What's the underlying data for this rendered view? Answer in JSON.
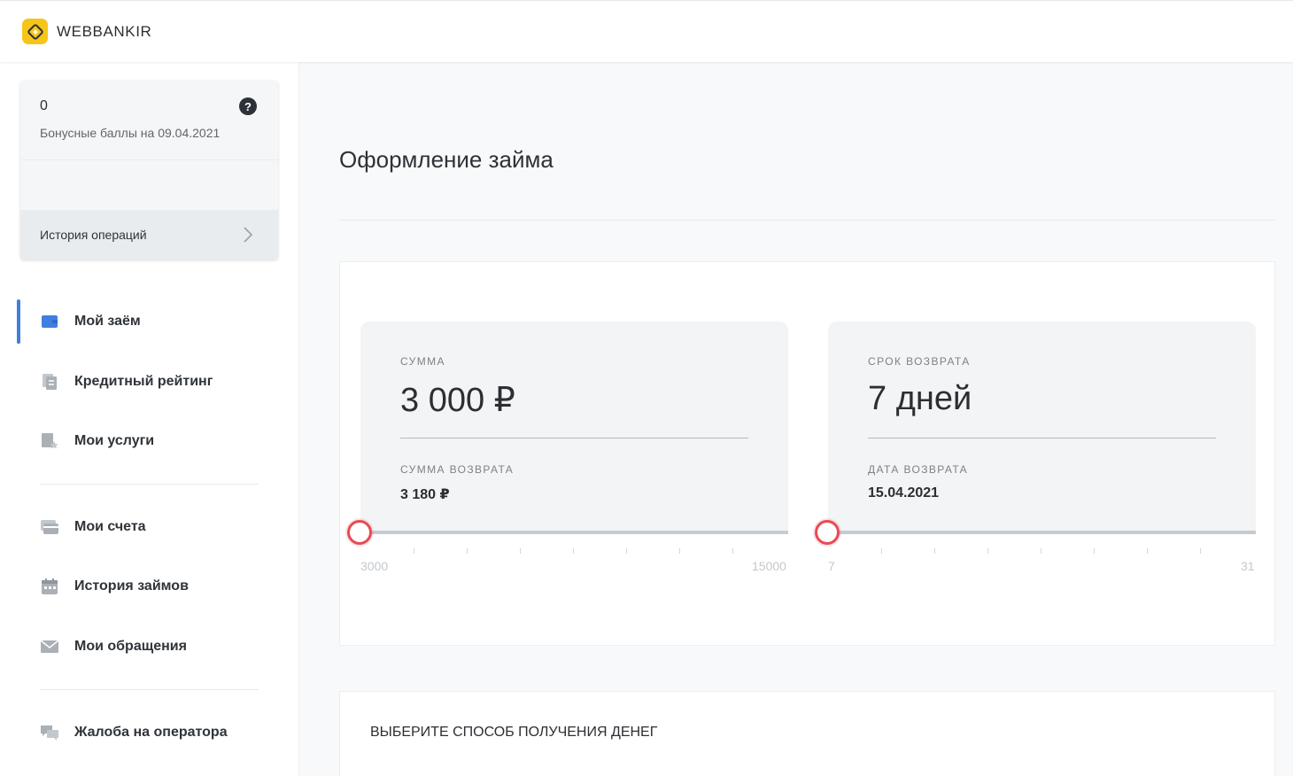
{
  "brand": {
    "name": "WEBBANKIR"
  },
  "bonus": {
    "value": "0",
    "label": "Бонусные баллы на 09.04.2021",
    "help_glyph": "?",
    "history_label": "История операций"
  },
  "nav": {
    "items": [
      {
        "label": "Мой заём",
        "icon": "wallet-icon",
        "active": true
      },
      {
        "label": "Кредитный рейтинг",
        "icon": "documents-icon"
      },
      {
        "label": "Мои услуги",
        "icon": "services-icon"
      },
      {
        "label": "Мои счета",
        "icon": "cards-icon"
      },
      {
        "label": "История займов",
        "icon": "calendar-icon"
      },
      {
        "label": "Мои обращения",
        "icon": "envelope-icon"
      },
      {
        "label": "Жалоба на оператора",
        "icon": "chat-icon"
      }
    ]
  },
  "main": {
    "title": "Оформление займа",
    "sum": {
      "caption": "СУММА",
      "value": "3 000 ₽",
      "return_caption": "СУММА ВОЗВРАТА",
      "return_value": "3 180 ₽",
      "slider": {
        "min": "3000",
        "max": "15000",
        "current": 3000
      }
    },
    "term": {
      "caption": "СРОК ВОЗВРАТА",
      "value": "7 дней",
      "date_caption": "ДАТА ВОЗВРАТА",
      "date_value": "15.04.2021",
      "slider": {
        "min": "7",
        "max": "31",
        "current": 7
      }
    },
    "method_title": "ВЫБЕРИТЕ СПОСОБ ПОЛУЧЕНИЯ ДЕНЕГ"
  },
  "colors": {
    "accent": "#3f7fe0",
    "knob": "#e64b55",
    "logo": "#f5c518"
  }
}
